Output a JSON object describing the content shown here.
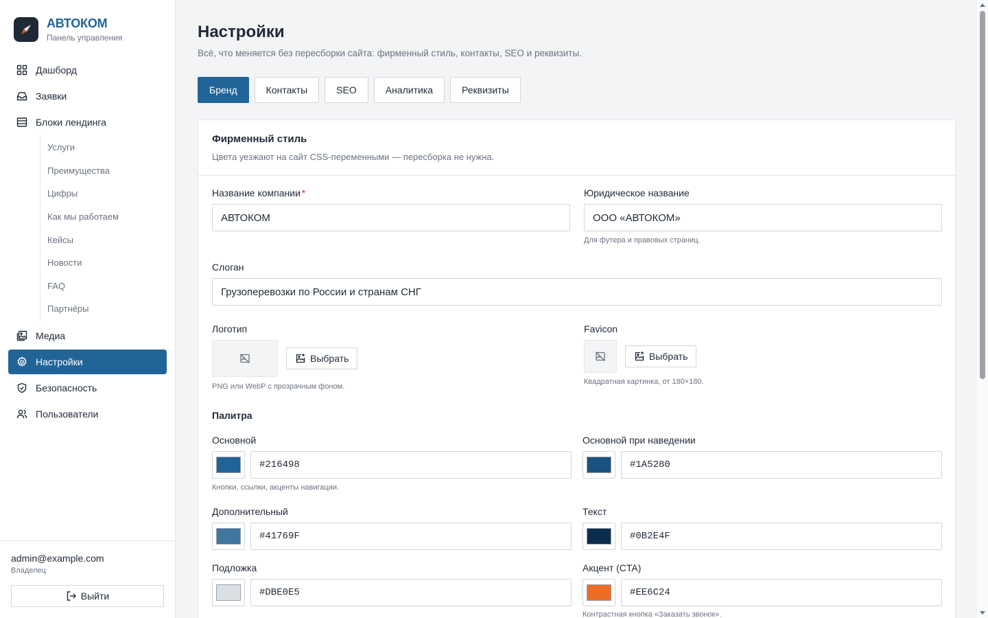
{
  "brand": {
    "title": "АВТОКОМ",
    "subtitle": "Панель управления"
  },
  "nav": {
    "dashboard": "Дашборд",
    "requests": "Заявки",
    "landing_blocks": "Блоки лендинга",
    "sub_items": [
      "Услуги",
      "Преимущества",
      "Цифры",
      "Как мы работаем",
      "Кейсы",
      "Новости",
      "FAQ",
      "Партнёры"
    ],
    "media": "Медиа",
    "settings": "Настройки",
    "security": "Безопасность",
    "users": "Пользователи"
  },
  "user": {
    "email": "admin@example.com",
    "role": "Владелец",
    "logout": "Выйти"
  },
  "page": {
    "title": "Настройки",
    "description": "Всё, что меняется без пересборки сайта: фирменный стиль, контакты, SEO и реквизиты."
  },
  "tabs": [
    "Бренд",
    "Контакты",
    "SEO",
    "Аналитика",
    "Реквизиты"
  ],
  "active_tab": "Бренд",
  "card": {
    "title": "Фирменный стиль",
    "subtitle": "Цвета уезжают на сайт CSS-переменными — пересборка не нужна."
  },
  "form": {
    "company_name": {
      "label": "Название компании",
      "required_mark": "*",
      "value": "АВТОКОМ"
    },
    "legal_name": {
      "label": "Юридическое название",
      "value": "ООО «АВТОКОМ»",
      "hint": "Для футера и правовых страниц."
    },
    "slogan": {
      "label": "Слоган",
      "value": "Грузоперевозки по России и странам СНГ"
    },
    "logo": {
      "label": "Логотип",
      "button": "Выбрать",
      "hint": "PNG или WebP с прозрачным фоном."
    },
    "favicon": {
      "label": "Favicon",
      "button": "Выбрать",
      "hint": "Квадратная картинка, от 180×180."
    }
  },
  "palette": {
    "label": "Палитра",
    "primary": {
      "label": "Основной",
      "value": "#216498",
      "hint": "Кнопки, ссылки, акценты навигации."
    },
    "primary_hover": {
      "label": "Основной при наведении",
      "value": "#1A5280"
    },
    "secondary": {
      "label": "Дополнительный",
      "value": "#41769F"
    },
    "text": {
      "label": "Текст",
      "value": "#0B2E4F"
    },
    "background": {
      "label": "Подложка",
      "value": "#DBE0E5"
    },
    "accent": {
      "label": "Акцент (CTA)",
      "value": "#EE6C24",
      "hint": "Контрастная кнопка «Заказать звонок»."
    }
  },
  "colors": {
    "brand": "#216498",
    "sidebar_bg": "#ffffff",
    "page_bg": "#f3f4f6"
  },
  "icons": {
    "logo": "compass-arrow-icon",
    "dashboard": "grid-icon",
    "requests": "inbox-icon",
    "landing_blocks": "layers-icon",
    "media": "image-stack-icon",
    "settings": "gear-icon",
    "security": "shield-icon",
    "users": "users-icon",
    "logout": "logout-icon",
    "image_off": "image-off-icon",
    "image_add": "image-plus-icon"
  }
}
